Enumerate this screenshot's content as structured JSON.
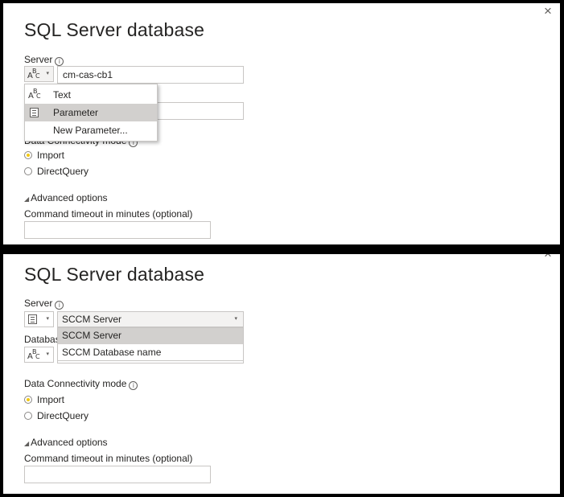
{
  "top": {
    "title": "SQL Server database",
    "server_label": "Server",
    "info_glyph": "i",
    "close_glyph": "×",
    "server_value": "cm-cas-cb1",
    "type_menu": [
      {
        "label": "Text",
        "icon": "abc-icon",
        "highlighted": false
      },
      {
        "label": "Parameter",
        "icon": "parameter-icon",
        "highlighted": true
      },
      {
        "label": "New Parameter...",
        "icon": "",
        "highlighted": false
      }
    ],
    "connectivity_label": "Data Connectivity mode",
    "radio_import": "Import",
    "radio_directquery": "DirectQuery",
    "advanced_label": "Advanced options",
    "timeout_label": "Command timeout in minutes (optional)",
    "timeout_value": ""
  },
  "bottom": {
    "title": "SQL Server database",
    "server_label": "Server",
    "info_glyph": "i",
    "close_glyph": "×",
    "server_selected": "SCCM Server",
    "server_options": [
      {
        "label": "SCCM Server",
        "highlighted": true
      },
      {
        "label": "SCCM Database name",
        "highlighted": false
      }
    ],
    "database_label": "Databas",
    "connectivity_label": "Data Connectivity mode",
    "radio_import": "Import",
    "radio_directquery": "DirectQuery",
    "advanced_label": "Advanced options",
    "timeout_label": "Command timeout in minutes (optional)",
    "timeout_value": ""
  },
  "abc_glyph": {
    "a": "A",
    "b": "B",
    "c": "C"
  },
  "caret_glyph": "▾",
  "adv_glyph": "◢",
  "colors": {
    "accent_radio": "#f2c811",
    "highlight": "#d2d0ce"
  }
}
